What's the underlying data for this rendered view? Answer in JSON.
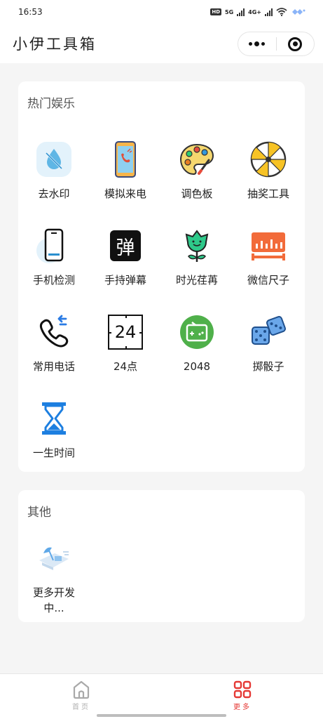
{
  "status_bar": {
    "time": "16:53",
    "hd": "HD",
    "net1": "5G",
    "net2": "4G+"
  },
  "nav": {
    "title": "小伊工具箱"
  },
  "sections": [
    {
      "title": "热门娱乐",
      "items": [
        {
          "label": "去水印",
          "icon": "watermark-drop-icon"
        },
        {
          "label": "模拟来电",
          "icon": "phone-call-icon"
        },
        {
          "label": "调色板",
          "icon": "palette-icon"
        },
        {
          "label": "抽奖工具",
          "icon": "lottery-wheel-icon"
        },
        {
          "label": "手机检测",
          "icon": "phone-check-icon"
        },
        {
          "label": "手持弹幕",
          "icon": "danmaku-icon",
          "glyph": "弹"
        },
        {
          "label": "时光荏苒",
          "icon": "flower-icon"
        },
        {
          "label": "微信尺子",
          "icon": "ruler-icon"
        },
        {
          "label": "常用电话",
          "icon": "phone-contacts-icon"
        },
        {
          "label": "24点",
          "icon": "24-points-icon",
          "glyph": "24"
        },
        {
          "label": "2048",
          "icon": "2048-gamepad-icon"
        },
        {
          "label": "掷骰子",
          "icon": "dice-icon"
        },
        {
          "label": "一生时间",
          "icon": "hourglass-icon"
        }
      ]
    },
    {
      "title": "其他",
      "items": [
        {
          "label": "更多开发中...",
          "icon": "coming-soon-icon"
        }
      ]
    }
  ],
  "tabs": [
    {
      "label": "首页",
      "icon": "home-icon",
      "color": "#b0b0b0"
    },
    {
      "label": "更多",
      "icon": "grid-icon",
      "color": "#e53935"
    }
  ],
  "colors": {
    "accent_red": "#e53935",
    "bg": "#f5f5f5",
    "card": "#ffffff"
  }
}
